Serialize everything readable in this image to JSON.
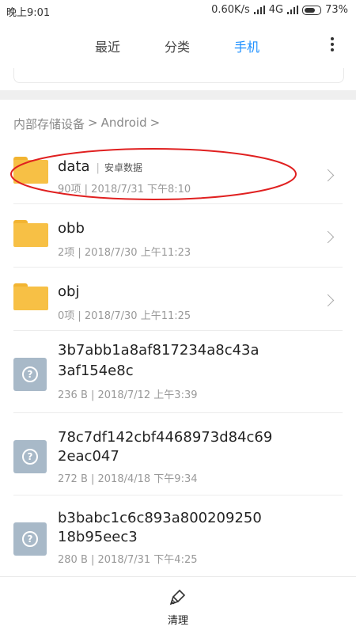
{
  "status": {
    "time": "晚上9:01",
    "net_speed": "0.60K/s",
    "network": "4G",
    "battery": "73%"
  },
  "tabs": {
    "recent": "最近",
    "category": "分类",
    "phone": "手机"
  },
  "breadcrumb": {
    "root": "内部存储设备",
    "sep1": ">",
    "folder": "Android",
    "sep2": ">"
  },
  "items": [
    {
      "name": "data",
      "tag": "安卓数据",
      "meta": "90项 | 2018/7/31 下午8:10",
      "type": "folder"
    },
    {
      "name": "obb",
      "meta": "2项 | 2018/7/30 上午11:23",
      "type": "folder"
    },
    {
      "name": "obj",
      "meta": "0项 | 2018/7/30 上午11:25",
      "type": "folder"
    },
    {
      "name_line1": "3b7abb1a8af817234a8c43a",
      "name_line2": "3af154e8c",
      "meta": "236 B | 2018/7/12 上午3:39",
      "type": "file"
    },
    {
      "name_line1": "78c7df142cbf4468973d84c69",
      "name_line2": "2eac047",
      "meta": "272 B | 2018/4/18 下午9:34",
      "type": "file"
    },
    {
      "name_line1": "b3babc1c6c893a800209250",
      "name_line2": "18b95eec3",
      "meta": "280 B | 2018/7/31 下午4:25",
      "type": "file"
    }
  ],
  "bottom": {
    "clean_label": "清理",
    "icon": "broom-icon"
  },
  "colors": {
    "accent": "#1e90ff",
    "folder": "#f7c045",
    "file": "#a8b9c8",
    "highlight": "#e02020"
  }
}
